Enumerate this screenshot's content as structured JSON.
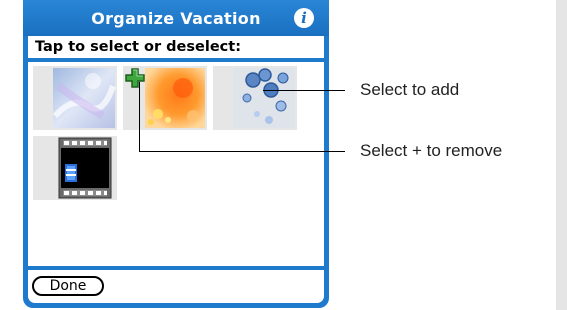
{
  "window": {
    "title": "Organize Vacation",
    "info_icon": "i"
  },
  "screen": {
    "instruction": "Tap to select or deselect:",
    "thumbnails": [
      {
        "name": "photo-frost",
        "selected": false
      },
      {
        "name": "photo-orange-bokeh",
        "selected": true
      },
      {
        "name": "photo-blue-bubbles",
        "selected": false
      },
      {
        "name": "video-clip",
        "selected": false
      }
    ],
    "done_label": "Done"
  },
  "callouts": {
    "select_to_add": "Select to add",
    "select_plus_to_remove": "Select + to remove"
  },
  "colors": {
    "accent": "#1e7acc",
    "plus": "#2e8b2e"
  },
  "icons": [
    "info-icon",
    "plus-icon",
    "film-strip-icon"
  ]
}
